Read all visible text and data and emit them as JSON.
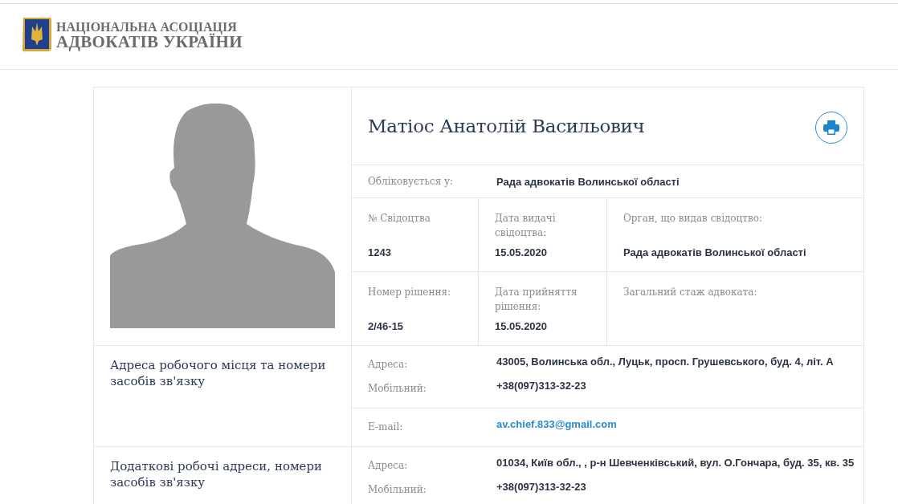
{
  "header": {
    "logo_lines": [
      "НАЦІОНАЛЬНА АСОЦІАЦІЯ",
      "АДВОКАТІВ УКРАЇНИ"
    ]
  },
  "profile": {
    "name": "Матіос Анатолій Васильович",
    "registered": {
      "label": "Обліковується у:",
      "value": "Рада адвокатів Волинської області"
    },
    "details": [
      [
        {
          "label": "№ Свідоцтва",
          "value": "1243"
        },
        {
          "label": "Дата видачі свідоцтва:",
          "value": "15.05.2020"
        },
        {
          "label": "Орган, що видав свідоцтво:",
          "value": "Рада адвокатів Волинської області"
        }
      ],
      [
        {
          "label": "Номер рішення:",
          "value": "2/46-15"
        },
        {
          "label": "Дата прийняття рішення:",
          "value": "15.05.2020"
        },
        {
          "label": "Загальний стаж адвоката:"
        }
      ]
    ]
  },
  "contact_sections": [
    {
      "title": "Адреса робочого місця та номери засобів зв'язку",
      "groups": [
        [
          {
            "label": "Адреса:",
            "value": "43005, Волинська обл., Луцьк, просп. Грушевського, буд. 4, літ. А",
            "kind": "text"
          },
          {
            "label": "Мобільний:",
            "value": "+38(097)313-32-23",
            "kind": "text"
          }
        ],
        [
          {
            "label": "E-mail:",
            "value": "av.chief.833@gmail.com",
            "kind": "link"
          }
        ]
      ]
    },
    {
      "title": "Додаткові робочі адреси, номери засобів зв'язку",
      "groups": [
        [
          {
            "label": "Адреса:",
            "value": "01034, Київ обл., , р-н Шевченківський, вул. О.Гончара, буд. 35, кв. 35",
            "kind": "text"
          },
          {
            "label": "Мобільний:",
            "value": "+38(097)313-32-23",
            "kind": "text"
          }
        ]
      ]
    }
  ]
}
